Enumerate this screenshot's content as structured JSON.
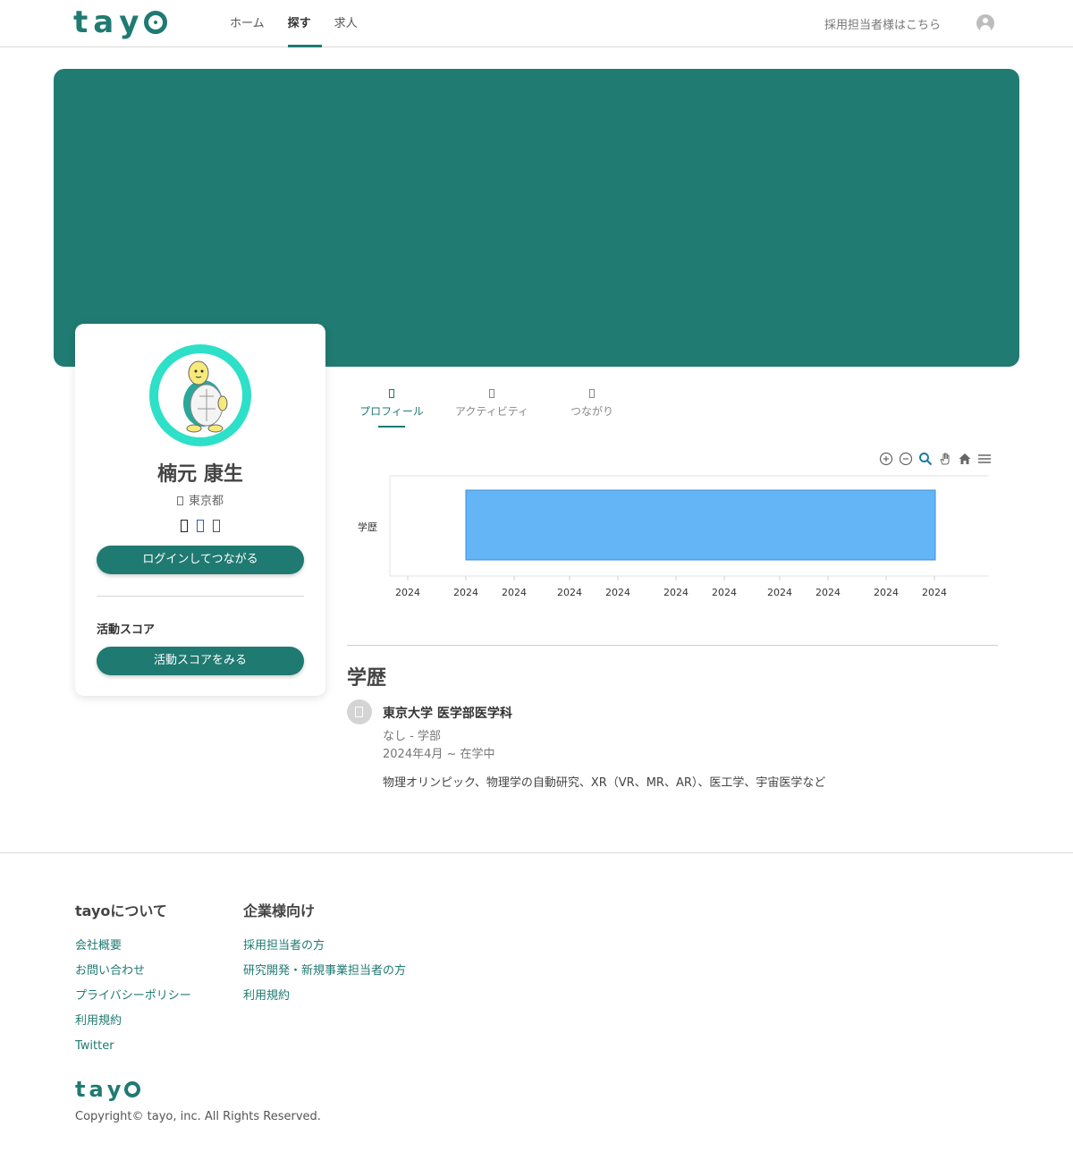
{
  "brand": {
    "logo_letters": [
      "t",
      "a",
      "y",
      "o"
    ],
    "color": "#1f7a72"
  },
  "header": {
    "nav": [
      {
        "label": "ホーム"
      },
      {
        "label": "探す"
      },
      {
        "label": "求人"
      }
    ],
    "active_nav": "探す",
    "recruiter_link": "採用担当者様はこちら"
  },
  "banner": {
    "color": "#207b73"
  },
  "profile": {
    "name": "楠元 康生",
    "location": "東京都",
    "login_button": "ログインしてつながる",
    "score_heading": "活動スコア",
    "score_button": "活動スコアをみる",
    "avatar_ring_color": "#2de0c7"
  },
  "tabs": [
    {
      "label": "プロフィール",
      "active": true
    },
    {
      "label": "アクティビティ",
      "active": false
    },
    {
      "label": "つながり",
      "active": false
    }
  ],
  "chart_data": {
    "type": "bar",
    "orientation": "horizontal-timeline",
    "categories": [
      "学歴"
    ],
    "x_tick_labels": [
      "2024",
      "2024",
      "2024",
      "2024",
      "2024",
      "2024",
      "2024",
      "2024",
      "2024",
      "2024",
      "2024"
    ],
    "bar_color": "#64b5f6",
    "grid": false,
    "toolbar_icons": [
      "zoom-in-icon",
      "zoom-out-icon",
      "zoom-selection-icon",
      "pan-icon",
      "reset-home-icon",
      "menu-icon"
    ]
  },
  "education": {
    "heading": "学歴",
    "school": "東京大学 医学部医学科",
    "dept": "なし - 学部",
    "period": "2024年4月 ~ 在学中",
    "note": "物理オリンピック、物理学の自動研究、XR（VR、MR、AR）、医工学、宇宙医学など"
  },
  "footer": {
    "col1": {
      "heading": "tayoについて",
      "links": [
        "会社概要",
        "お問い合わせ",
        "プライバシーポリシー",
        "利用規約",
        "Twitter"
      ]
    },
    "col2": {
      "heading": "企業様向け",
      "links": [
        "採用担当者の方",
        "研究開発・新規事業担当者の方",
        "利用規約"
      ]
    },
    "copyright": "Copyright© tayo, inc. All Rights Reserved."
  }
}
